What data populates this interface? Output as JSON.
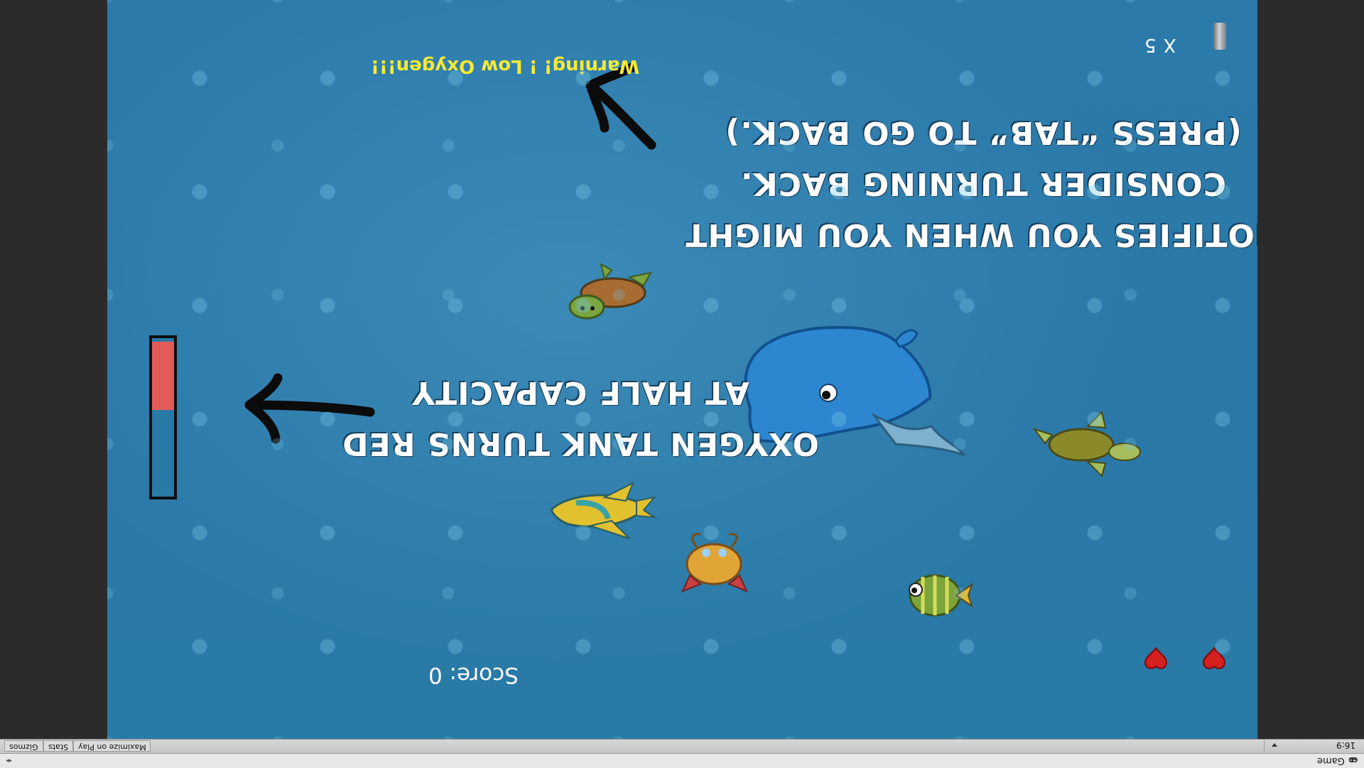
{
  "window": {
    "tab_title": "Game"
  },
  "toolbar": {
    "aspect_ratio": "16:9",
    "buttons": [
      "Maximize on Play",
      "Stats",
      "Gizmos"
    ]
  },
  "game": {
    "lives_label": "X 5",
    "warning": "Warning! ! Low Oxygen!!!",
    "score_label": "Score: 0",
    "hearts": 2,
    "oxygen_level": 0.4,
    "tutorial_tips": {
      "turn_back": "NOTIFIES YOU WHEN YOU MIGHT CONSIDER TURNING BACK. (PRESS “TAB” TO GO BACK.)",
      "oxygen_tank": "OXYGEN TANK TURNS RED AT HALF CAPACITY"
    },
    "creatures": [
      "whale",
      "turtle",
      "turtle",
      "angelfish",
      "crab",
      "striped-fish"
    ],
    "colors": {
      "water": "#2a78a8",
      "warning": "#f7ea35",
      "oxygen_low": "#e15b59",
      "heart": "#d61f1f"
    }
  }
}
